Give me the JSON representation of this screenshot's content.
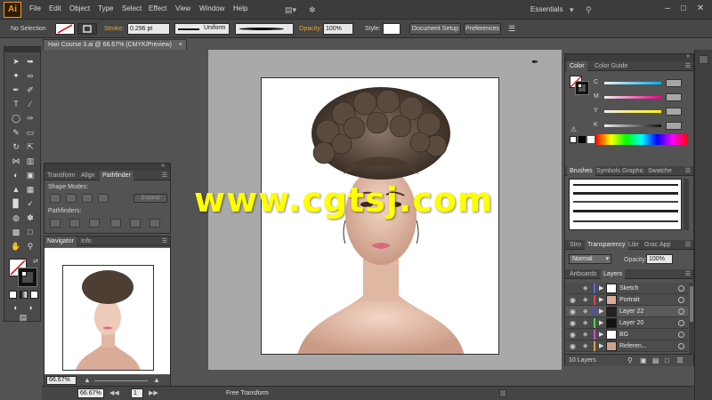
{
  "app": {
    "logo": "Ai",
    "workspace": "Essentials"
  },
  "menu": [
    "File",
    "Edit",
    "Object",
    "Type",
    "Select",
    "Effect",
    "View",
    "Window",
    "Help"
  ],
  "control_bar": {
    "selection": "No Selection",
    "stroke_label": "Stroke:",
    "stroke_value": "0.296 pt",
    "profile": "Uniform",
    "opacity_label": "Opacity:",
    "opacity_value": "100%",
    "style_label": "Style:",
    "document_setup": "Document Setup",
    "preferences": "Preferences"
  },
  "document_tab": "Hair Course 3.ai @ 66.67% (CMYK/Preview)",
  "pathfinder_panel": {
    "tabs": [
      "Transform",
      "Align",
      "Pathfinder"
    ],
    "shape_modes": "Shape Modes:",
    "expand": "Expand",
    "pathfinders": "Pathfinders:"
  },
  "navigator_panel": {
    "tabs": [
      "Navigator",
      "Info"
    ],
    "zoom": "66.67%"
  },
  "color_panel": {
    "tabs": [
      "Color",
      "Color Guide"
    ],
    "channels": [
      "C",
      "M",
      "Y",
      "K"
    ]
  },
  "brushes_panel": {
    "tabs": [
      "Brushes",
      "Symbols",
      "Graphic",
      "Swatche"
    ]
  },
  "transparency_panel": {
    "tabs": [
      "Stro",
      "Transparency",
      "Libr",
      "Grac",
      "App"
    ],
    "blend_mode": "Normal",
    "opacity_label": "Opacity:",
    "opacity_value": "100%"
  },
  "layers_panel": {
    "tabs": [
      "Artboards",
      "Layers"
    ],
    "layers": [
      {
        "name": "Sketch",
        "color": "#4f6fd6"
      },
      {
        "name": "Portrait",
        "color": "#d84a4a"
      },
      {
        "name": "Layer 22",
        "color": "#4a4ad8"
      },
      {
        "name": "Layer 20",
        "color": "#4ad84a"
      },
      {
        "name": "BG",
        "color": "#d84ad8"
      },
      {
        "name": "Referen...",
        "color": "#d8a04a"
      }
    ],
    "count": "10 Layers"
  },
  "status_bar": {
    "zoom": "66.67%",
    "page": "1",
    "tool": "Free Transform"
  },
  "watermark": "www.cgtsj.com"
}
